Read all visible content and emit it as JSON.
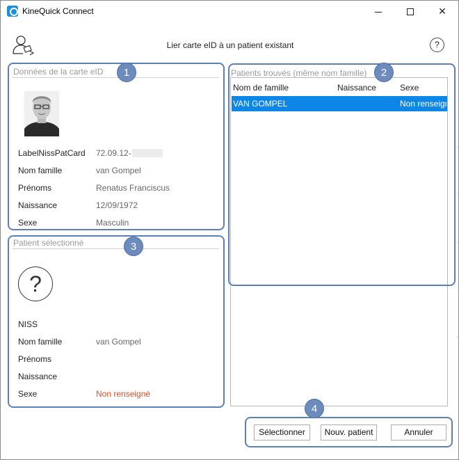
{
  "window": {
    "title": "KineQuick Connect",
    "buttons": {
      "minimize": "minimize",
      "maximize": "maximize",
      "close": "✕"
    }
  },
  "header": {
    "title": "Lier carte eID à un patient existant",
    "help_label": "?"
  },
  "eid_card": {
    "group_title": "Données de la carte eID",
    "badge": "1",
    "fields": [
      {
        "label": "LabelNissPatCard",
        "value": "72.09.12-"
      },
      {
        "label": "Nom famille",
        "value": "van Gompel"
      },
      {
        "label": "Prénoms",
        "value": "Renatus Franciscus"
      },
      {
        "label": "Naissance",
        "value": "12/09/1972"
      },
      {
        "label": "Sexe",
        "value": "Masculin"
      }
    ]
  },
  "found_patients": {
    "group_title": "Patients trouvés (même nom famille)",
    "badge": "2",
    "columns": [
      "Nom de famille",
      "Naissance",
      "Sexe"
    ],
    "rows": [
      {
        "nom": "VAN GOMPEL",
        "naissance": "",
        "sexe": "Non renseigné"
      }
    ]
  },
  "selected_patient": {
    "group_title": "Patient sélectionné",
    "badge": "3",
    "placeholder_icon": "?",
    "fields": [
      {
        "label": "NISS",
        "value": ""
      },
      {
        "label": "Nom famille",
        "value": "van Gompel"
      },
      {
        "label": "Prénoms",
        "value": ""
      },
      {
        "label": "Naissance",
        "value": ""
      },
      {
        "label": "Sexe",
        "value": "Non renseigné"
      }
    ]
  },
  "actions": {
    "badge": "4",
    "select_label": "Sélectionner",
    "new_patient_label": "Nouv. patient",
    "cancel_label": "Annuler"
  },
  "colors": {
    "accent": "#0e86e8",
    "callout": "#5d7fb3",
    "warning": "#d8502a"
  }
}
